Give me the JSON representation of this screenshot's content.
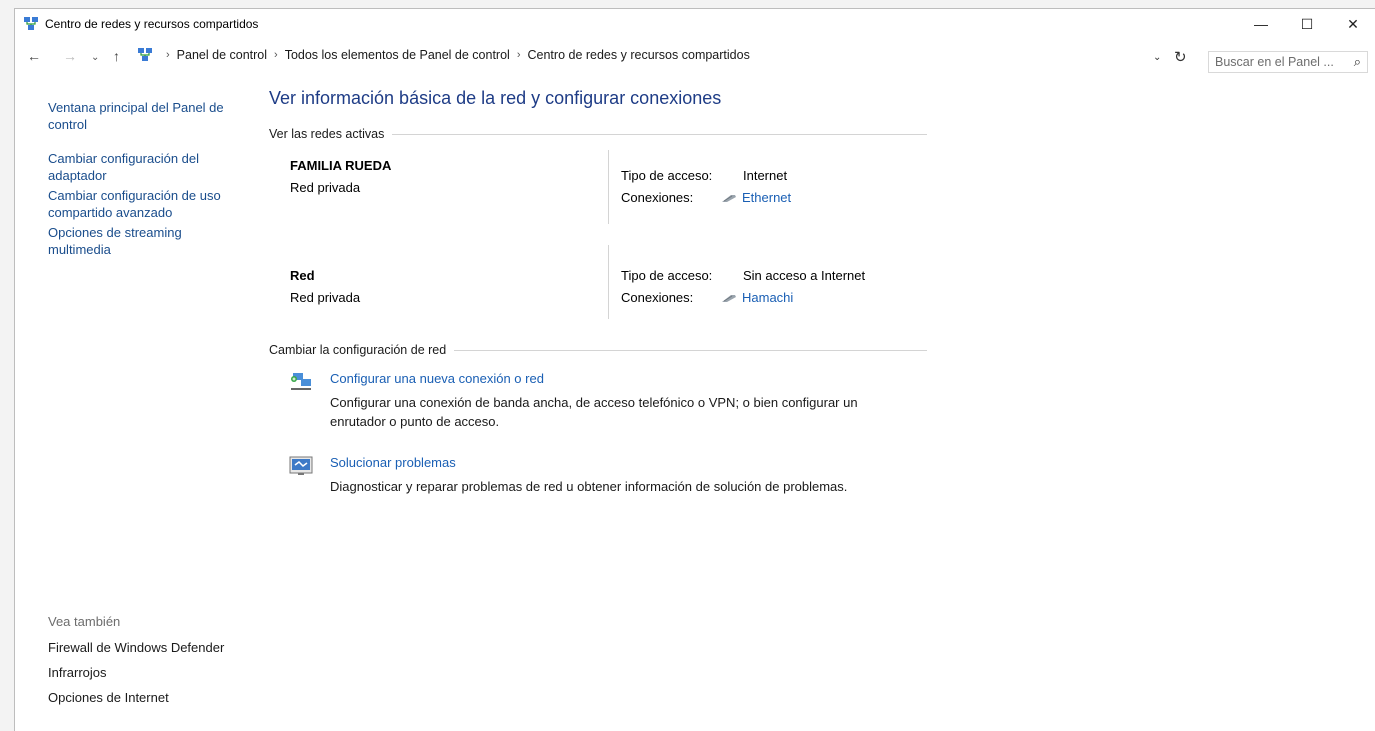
{
  "window": {
    "title": "Centro de redes y recursos compartidos",
    "controls": {
      "minimize": "—",
      "maximize": "☐",
      "close": "✕"
    }
  },
  "nav": {
    "back": "←",
    "forward": "→",
    "recent": "⌄",
    "up": "↑",
    "breadcrumb": [
      "Panel de control",
      "Todos los elementos de Panel de control",
      "Centro de redes y recursos compartidos"
    ],
    "search_placeholder": "Buscar en el Panel ..."
  },
  "sidebar": {
    "links": [
      "Ventana principal del Panel de control",
      "Cambiar configuración del adaptador",
      "Cambiar configuración de uso compartido avanzado",
      "Opciones de streaming multimedia"
    ],
    "see_also_title": "Vea también",
    "see_also": [
      "Firewall de Windows Defender",
      "Infrarrojos",
      "Opciones de Internet"
    ]
  },
  "main": {
    "title": "Ver información básica de la red y configurar conexiones",
    "active_networks_header": "Ver las redes activas",
    "networks": [
      {
        "name": "FAMILIA RUEDA",
        "type": "Red privada",
        "access_label": "Tipo de acceso:",
        "access_value": "Internet",
        "connections_label": "Conexiones:",
        "connection": "Ethernet"
      },
      {
        "name": "Red",
        "type": "Red privada",
        "access_label": "Tipo de acceso:",
        "access_value": "Sin acceso a Internet",
        "connections_label": "Conexiones:",
        "connection": "Hamachi"
      }
    ],
    "change_settings_header": "Cambiar la configuración de red",
    "tasks": [
      {
        "link": "Configurar una nueva conexión o red",
        "description": "Configurar una conexión de banda ancha, de acceso telefónico o VPN; o bien configurar un enrutador o punto de acceso."
      },
      {
        "link": "Solucionar problemas",
        "description": "Diagnosticar y reparar problemas de red u obtener información de solución de problemas."
      }
    ]
  }
}
